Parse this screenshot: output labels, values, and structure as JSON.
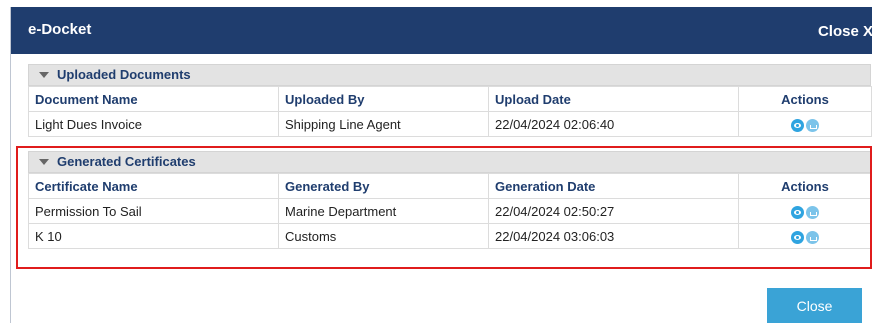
{
  "modal": {
    "title": "e-Docket",
    "close_x": "Close X"
  },
  "uploaded": {
    "section_title": "Uploaded Documents",
    "columns": [
      "Document Name",
      "Uploaded By",
      "Upload Date",
      "Actions"
    ],
    "rows": [
      {
        "name": "Light Dues Invoice",
        "by": "Shipping Line Agent",
        "date": "22/04/2024 02:06:40"
      }
    ]
  },
  "generated": {
    "section_title": "Generated Certificates",
    "columns": [
      "Certificate Name",
      "Generated By",
      "Generation Date",
      "Actions"
    ],
    "rows": [
      {
        "name": "Permission To Sail",
        "by": "Marine Department",
        "date": "22/04/2024 02:50:27"
      },
      {
        "name": "K 10",
        "by": "Customs",
        "date": "22/04/2024 03:06:03"
      }
    ]
  },
  "footer": {
    "close_label": "Close"
  },
  "icons": {
    "view": "eye-icon",
    "download": "download-icon"
  },
  "colors": {
    "header": "#1f3d6e",
    "accent": "#3aa3d6",
    "highlight": "#e01c1c"
  }
}
